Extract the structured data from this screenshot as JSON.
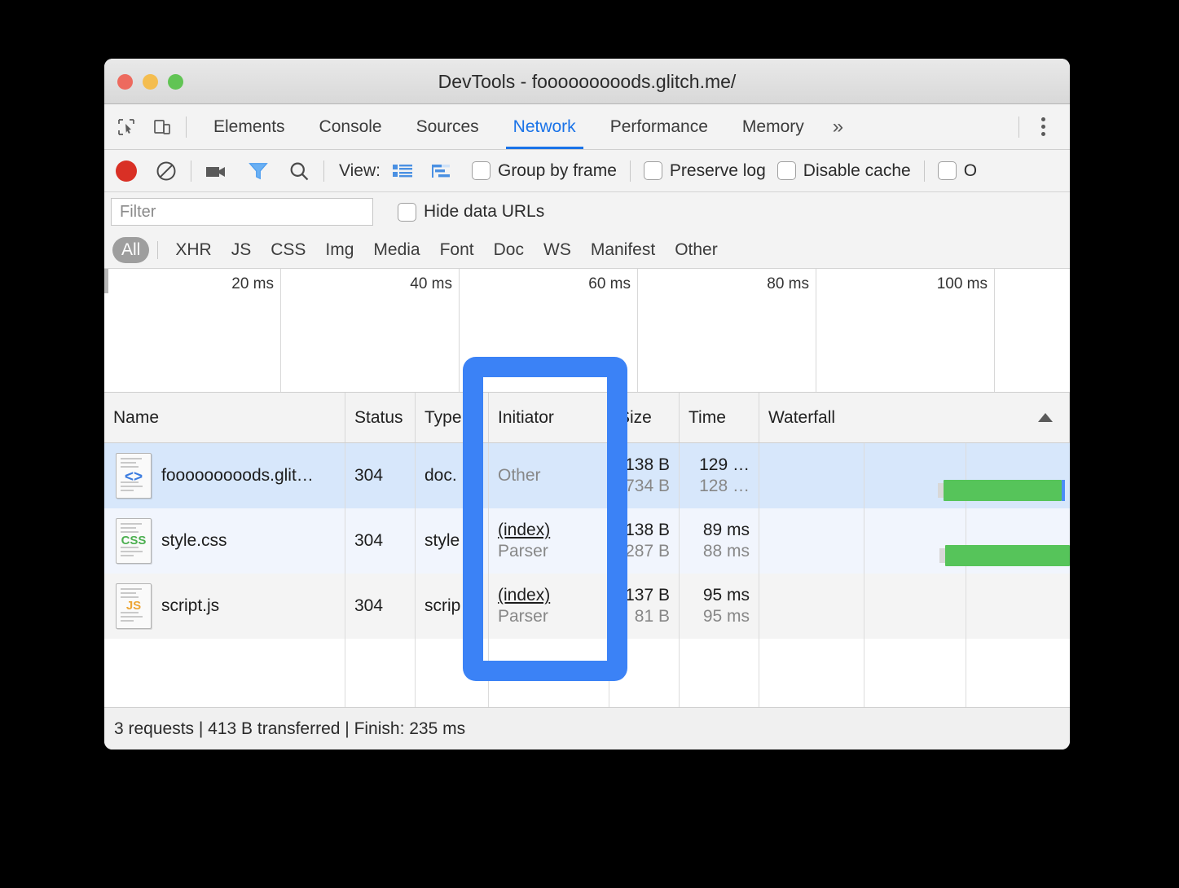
{
  "window": {
    "title": "DevTools - fooooooooods.glitch.me/",
    "traffic_lights": [
      "close-red",
      "minimize-yellow",
      "maximize-green"
    ]
  },
  "tabstrip": {
    "icons": [
      "inspect-element-icon",
      "device-toolbar-icon"
    ],
    "tabs": [
      {
        "label": "Elements",
        "active": false
      },
      {
        "label": "Console",
        "active": false
      },
      {
        "label": "Sources",
        "active": false
      },
      {
        "label": "Network",
        "active": true
      },
      {
        "label": "Performance",
        "active": false
      },
      {
        "label": "Memory",
        "active": false
      }
    ],
    "more_label": "»",
    "menu_icon": "kebab-menu-icon"
  },
  "toolbar": {
    "record_icon": "record-button-icon",
    "clear_icon": "clear-icon",
    "capture_screenshots_icon": "camera-icon",
    "filter_icon": "funnel-filter-icon",
    "search_icon": "search-icon",
    "view_label": "View:",
    "view_list_icon": "list-view-icon",
    "view_waterfall_icon": "waterfall-view-icon",
    "checkboxes": [
      {
        "label": "Group by frame",
        "checked": false
      },
      {
        "label": "Preserve log",
        "checked": false
      },
      {
        "label": "Disable cache",
        "checked": false
      },
      {
        "label": "O",
        "checked": false
      }
    ]
  },
  "filterbar": {
    "placeholder": "Filter",
    "value": "",
    "hide_data_urls_label": "Hide data URLs",
    "hide_data_urls_checked": false
  },
  "type_filters": {
    "items": [
      "All",
      "XHR",
      "JS",
      "CSS",
      "Img",
      "Media",
      "Font",
      "Doc",
      "WS",
      "Manifest",
      "Other"
    ],
    "active": "All"
  },
  "overview": {
    "ticks": [
      "20 ms",
      "40 ms",
      "60 ms",
      "80 ms",
      "100 ms"
    ]
  },
  "table": {
    "columns": [
      "Name",
      "Status",
      "Type",
      "Initiator",
      "Size",
      "Time",
      "Waterfall"
    ],
    "sort_column": "Waterfall",
    "sort_direction": "ascending",
    "rows": [
      {
        "icon": "html-document-icon",
        "icon_tag": "<>",
        "name": "fooooooooods.glit…",
        "status": "304",
        "type": "doc.",
        "initiator_primary": "Other",
        "initiator_secondary": "",
        "initiator_is_link": false,
        "size_primary": "138 B",
        "size_secondary": "734 B",
        "time_primary": "129 …",
        "time_secondary": "128 …",
        "selected": true
      },
      {
        "icon": "css-document-icon",
        "icon_tag": "CSS",
        "name": "style.css",
        "status": "304",
        "type": "style",
        "initiator_primary": "(index)",
        "initiator_secondary": "Parser",
        "initiator_is_link": true,
        "size_primary": "138 B",
        "size_secondary": "287 B",
        "time_primary": "89 ms",
        "time_secondary": "88 ms",
        "selected": false
      },
      {
        "icon": "js-document-icon",
        "icon_tag": "JS",
        "name": "script.js",
        "status": "304",
        "type": "scrip",
        "initiator_primary": "(index)",
        "initiator_secondary": "Parser",
        "initiator_is_link": true,
        "size_primary": "137 B",
        "size_secondary": "81 B",
        "time_primary": "95 ms",
        "time_secondary": "95 ms",
        "selected": false
      }
    ]
  },
  "statusbar": {
    "text": "3 requests | 413 B transferred | Finish: 235 ms"
  },
  "annotation": {
    "highlight_target": "initiator-column",
    "color": "#3b82f6"
  }
}
